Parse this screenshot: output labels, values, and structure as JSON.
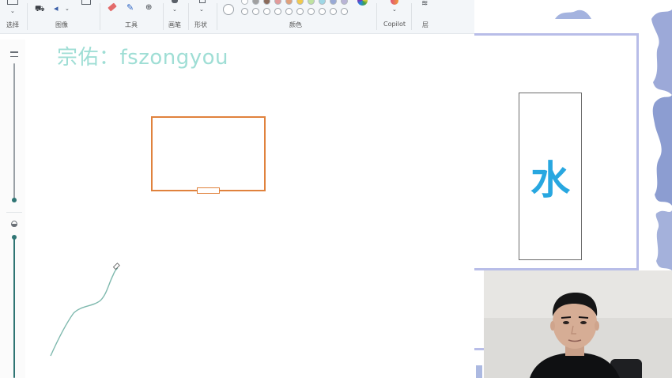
{
  "ribbon": {
    "groups": {
      "select": "选择",
      "image": "图像",
      "tools": "工具",
      "brushes": "画笔",
      "shapes": "形状",
      "colors": "颜色",
      "copilot": "Copilot",
      "layers": "层"
    }
  },
  "palette": {
    "row1": [
      "#ffffff",
      "#a0a0a0",
      "#8a6a5a",
      "#e29a9a",
      "#e0a07a",
      "#f2c94c",
      "#bfe3a0",
      "#9ed7e6",
      "#98a9d6",
      "#b9b4d6"
    ],
    "row2_count": 10
  },
  "canvas": {
    "watermark": "宗佑：fszongyou"
  },
  "reference_card": {
    "character": "水"
  },
  "colors": {
    "accent_teal": "#2f7574",
    "orange_stroke": "#e0823d",
    "watermark": "#9fded5",
    "water_char": "#28a7e0"
  }
}
